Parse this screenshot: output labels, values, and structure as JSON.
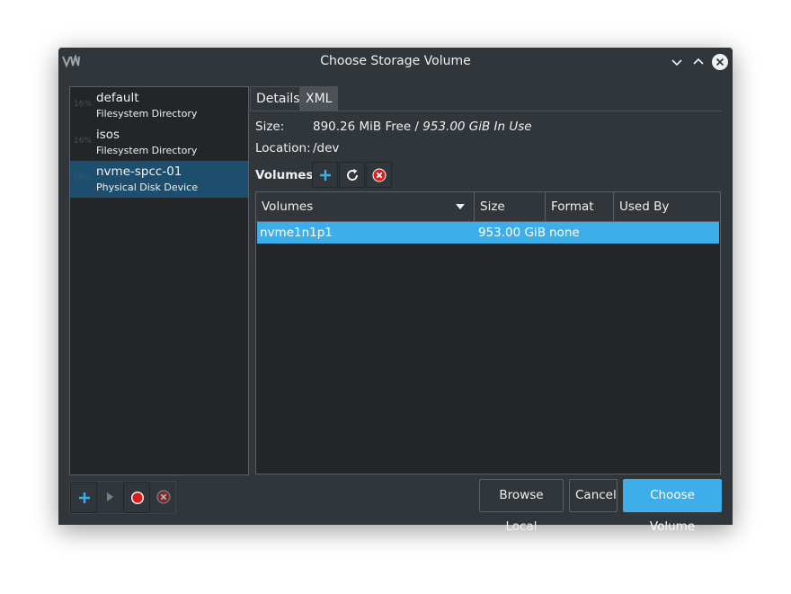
{
  "window": {
    "title": "Choose Storage Volume"
  },
  "pools": [
    {
      "usage": "16%",
      "name": "default",
      "type": "Filesystem Directory",
      "selected": false
    },
    {
      "usage": "16%",
      "name": "isos",
      "type": "Filesystem Directory",
      "selected": false
    },
    {
      "usage": "99%",
      "name": "nvme-spcc-01",
      "type": "Physical Disk Device",
      "selected": true
    }
  ],
  "tabs": [
    {
      "label": "Details",
      "active": true
    },
    {
      "label": "XML",
      "active": false
    }
  ],
  "details": {
    "size_label": "Size:",
    "size_free": "890.26 MiB Free / ",
    "size_in_use": "953.00 GiB In Use",
    "location_label": "Location:",
    "location_value": "/dev",
    "volumes_label": "Volumes"
  },
  "volume_table": {
    "columns": [
      "Volumes",
      "Size",
      "Format",
      "Used By"
    ],
    "rows": [
      {
        "name": "nvme1n1p1",
        "size": "953.00 GiB",
        "format": "none",
        "used_by": ""
      }
    ]
  },
  "buttons": {
    "browse_local": "Browse Local",
    "cancel": "Cancel",
    "choose_volume": "Choose Volume"
  },
  "colors": {
    "accent": "#3daee9",
    "window_bg": "#31363b",
    "view_bg": "#232629",
    "selected_pool": "#1e4e6e",
    "stop_red": "#da1e1e"
  },
  "icons": {
    "app": "virt-manager-icon",
    "minimize": "chevron-down-icon",
    "maximize": "chevron-up-icon",
    "close": "close-circle-icon",
    "add": "plus-icon",
    "refresh": "refresh-icon",
    "delete": "delete-circle-icon",
    "start": "play-icon",
    "stop": "stop-circle-icon"
  }
}
